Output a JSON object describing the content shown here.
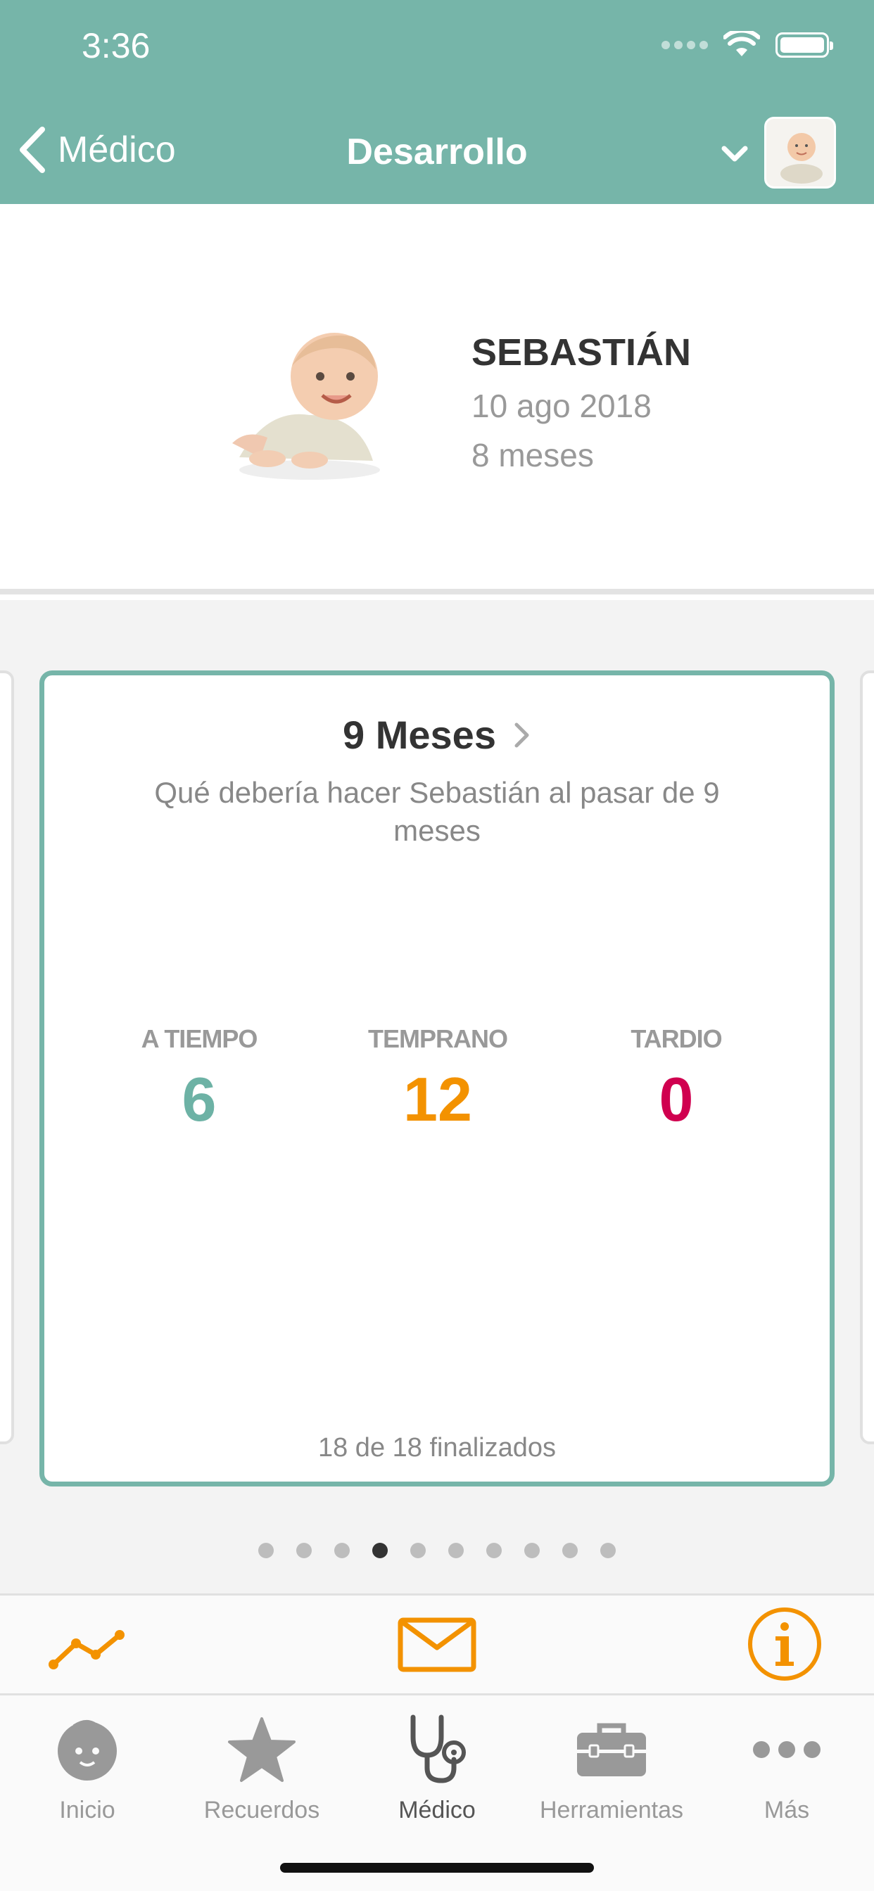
{
  "status_bar": {
    "time": "3:36"
  },
  "nav": {
    "back_label": "Médico",
    "title": "Desarrollo",
    "back_icon": "chevron-left-icon",
    "dropdown_icon": "chevron-down-icon"
  },
  "profile": {
    "name": "SEBASTIÁN",
    "birth_date": "10 ago 2018",
    "age": "8 meses"
  },
  "card": {
    "title": "9 Meses",
    "subtitle": "Qué debería hacer Sebastián al pasar de 9 meses",
    "stats": [
      {
        "label": "A TIEMPO",
        "value": "6",
        "color": "#6DB2A5"
      },
      {
        "label": "TEMPRANO",
        "value": "12",
        "color": "#F39200"
      },
      {
        "label": "TARDIO",
        "value": "0",
        "color": "#D0004F"
      }
    ],
    "footer": "18 de 18 finalizados"
  },
  "pagination": {
    "total": 10,
    "active_index": 3
  },
  "actions": {
    "chart_icon": "line-chart-icon",
    "mail_icon": "mail-icon",
    "info_icon": "info-icon",
    "accent_color": "#F39200"
  },
  "tabs": [
    {
      "label": "Inicio",
      "icon": "baby-face-icon",
      "active": false
    },
    {
      "label": "Recuerdos",
      "icon": "star-icon",
      "active": false
    },
    {
      "label": "Médico",
      "icon": "stethoscope-icon",
      "active": true
    },
    {
      "label": "Herramientas",
      "icon": "toolbox-icon",
      "active": false
    },
    {
      "label": "Más",
      "icon": "more-dots-icon",
      "active": false
    }
  ],
  "colors": {
    "header": "#76B5A9",
    "card_border": "#76B5A9"
  }
}
